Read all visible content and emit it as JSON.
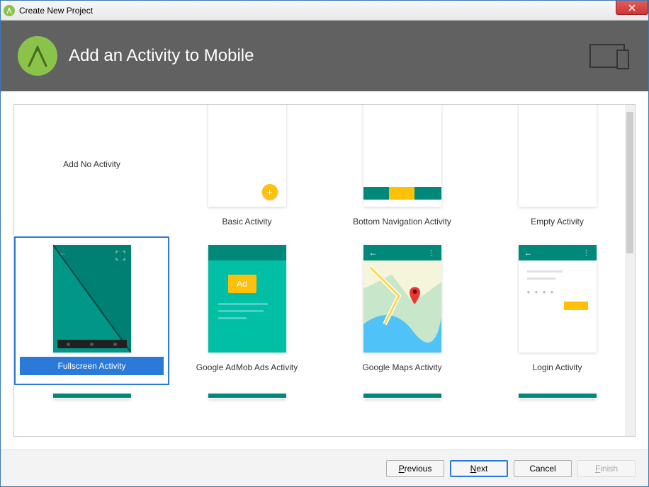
{
  "window": {
    "title": "Create New Project"
  },
  "header": {
    "title": "Add an Activity to Mobile"
  },
  "templates": {
    "no_activity": "Add No Activity",
    "basic": "Basic Activity",
    "bottom_nav": "Bottom Navigation Activity",
    "empty": "Empty Activity",
    "fullscreen": "Fullscreen Activity",
    "admob": "Google AdMob Ads Activity",
    "admob_ad_label": "Ad",
    "maps": "Google Maps Activity",
    "login": "Login Activity"
  },
  "selected_template": "fullscreen",
  "footer": {
    "previous": "Previous",
    "next": "Next",
    "cancel": "Cancel",
    "finish": "Finish"
  },
  "colors": {
    "accent": "#2b79d8",
    "teal": "#00897b",
    "tealLight": "#00bfa5",
    "amber": "#ffc107",
    "headerBg": "#616161",
    "logoBg": "#8bc34a"
  }
}
